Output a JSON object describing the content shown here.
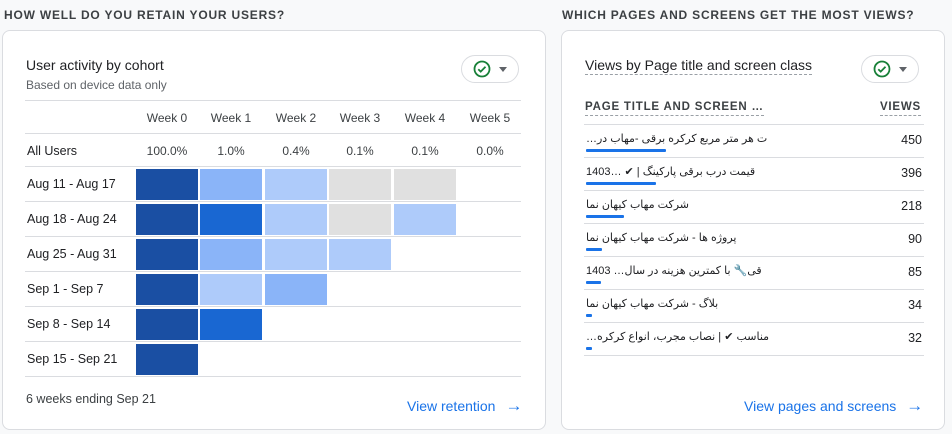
{
  "left": {
    "section_title": "HOW WELL DO YOU RETAIN YOUR USERS?",
    "card_title": "User activity by cohort",
    "card_subtitle": "Based on device data only",
    "weeks": [
      "Week 0",
      "Week 1",
      "Week 2",
      "Week 3",
      "Week 4",
      "Week 5"
    ],
    "all_users": {
      "label": "All Users",
      "values": [
        "100.0%",
        "1.0%",
        "0.4%",
        "0.1%",
        "0.1%",
        "0.0%"
      ]
    },
    "cohorts": [
      {
        "label": "Aug 11 - Aug 17",
        "cells": [
          "#1a4fa3",
          "#8ab4f8",
          "#aecbfa",
          "#e0e0e0",
          "#e0e0e0",
          ""
        ]
      },
      {
        "label": "Aug 18 - Aug 24",
        "cells": [
          "#1a4fa3",
          "#1967d2",
          "#aecbfa",
          "#e0e0e0",
          "#aecbfa",
          ""
        ]
      },
      {
        "label": "Aug 25 - Aug 31",
        "cells": [
          "#1a4fa3",
          "#8ab4f8",
          "#aecbfa",
          "#aecbfa",
          "",
          ""
        ]
      },
      {
        "label": "Sep 1 - Sep 7",
        "cells": [
          "#1a4fa3",
          "#aecbfa",
          "#8ab4f8",
          "",
          "",
          ""
        ]
      },
      {
        "label": "Sep 8 - Sep 14",
        "cells": [
          "#1a4fa3",
          "#1967d2",
          "",
          "",
          "",
          ""
        ]
      },
      {
        "label": "Sep 15 - Sep 21",
        "cells": [
          "#1a4fa3",
          "",
          "",
          "",
          "",
          ""
        ]
      }
    ],
    "footer": "6 weeks ending Sep 21",
    "link_label": "View retention"
  },
  "right": {
    "section_title": "WHICH PAGES AND SCREENS GET THE MOST VIEWS?",
    "card_title": "Views by Page title and screen class",
    "col_name": "PAGE TITLE AND SCREEN …",
    "col_value": "VIEWS",
    "rows": [
      {
        "name": "…ت هر متر مربع کرکره برقی -مهاب در",
        "value": "450",
        "share": 1.0
      },
      {
        "name": "1403… ✔ | قیمت درب برقی پارکینگ",
        "value": "396",
        "share": 0.88
      },
      {
        "name": "شرکت مهاب کیهان نما",
        "value": "218",
        "share": 0.48
      },
      {
        "name": "پروژه ها - شرکت مهاب کیهان نما",
        "value": "90",
        "share": 0.2
      },
      {
        "name": "1403 …قی🔧 با کمترین هزینه در سال",
        "value": "85",
        "share": 0.19
      },
      {
        "name": "بلاگ - شرکت مهاب کیهان نما",
        "value": "34",
        "share": 0.08
      },
      {
        "name": "…مناسب ✔ | نصاب مجرب، انواع کرکره",
        "value": "32",
        "share": 0.07
      }
    ],
    "link_label": "View pages and screens"
  },
  "colors": {
    "accent": "#1a73e8",
    "check": "#188038"
  }
}
